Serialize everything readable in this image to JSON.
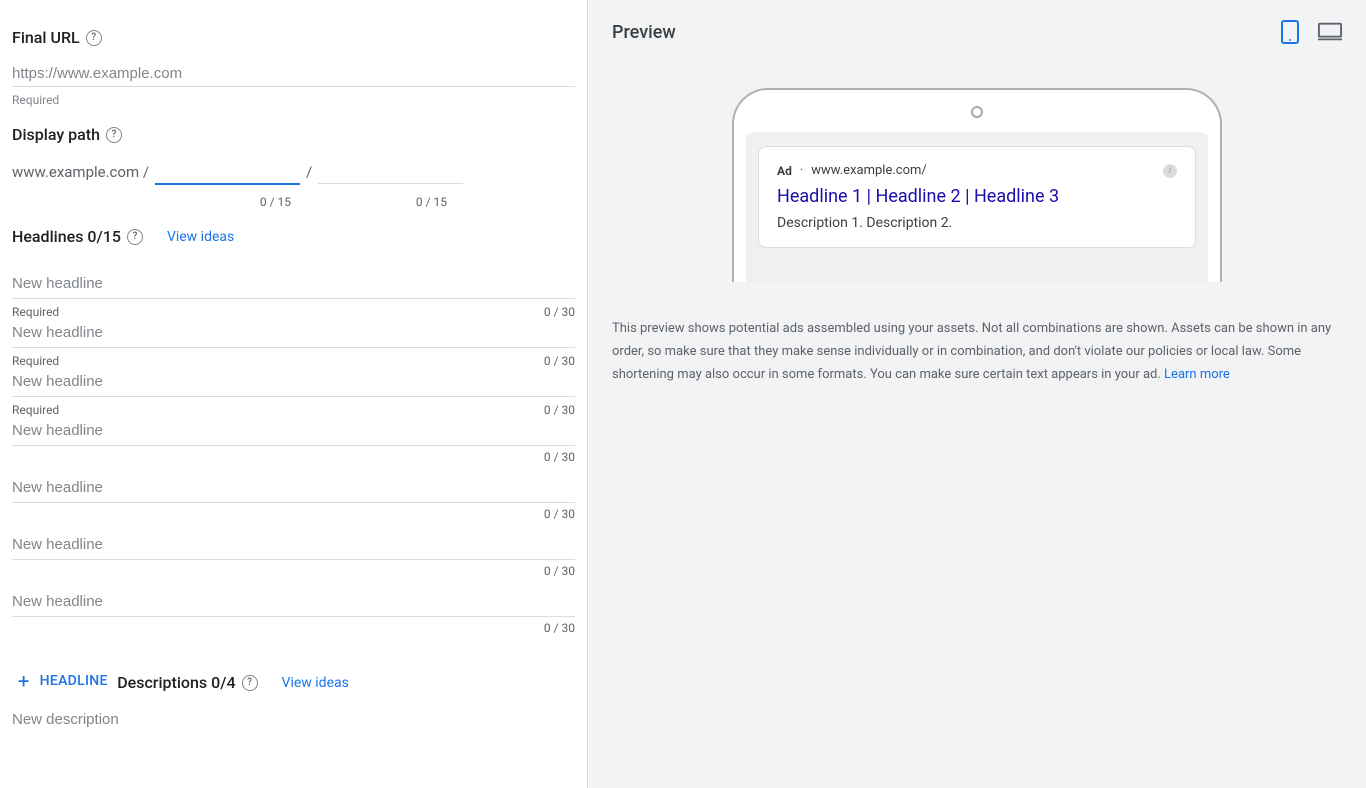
{
  "final_url": {
    "label": "Final URL",
    "placeholder": "https://www.example.com",
    "hint": "Required"
  },
  "display_path": {
    "label": "Display path",
    "prefix": "www.example.com /",
    "separator": "/",
    "counter1": "0 / 15",
    "counter2": "0 / 15"
  },
  "headlines": {
    "label": "Headlines 0/15",
    "view_ideas": "View ideas",
    "placeholder": "New headline",
    "required": "Required",
    "counter": "0 / 30",
    "add_button": "HEADLINE"
  },
  "descriptions": {
    "label": "Descriptions 0/4",
    "view_ideas": "View ideas",
    "placeholder": "New description"
  },
  "preview": {
    "title": "Preview",
    "ad_badge": "Ad",
    "ad_url": "www.example.com/",
    "ad_headline": "Headline 1 | Headline 2 | Headline 3",
    "ad_description": "Description 1. Description 2.",
    "explainer": "This preview shows potential ads assembled using your assets. Not all combinations are shown. Assets can be shown in any order, so make sure that they make sense individually or in combination, and don't violate our policies or local law. Some shortening may also occur in some formats. You can make sure certain text appears in your ad.",
    "learn_more": "Learn more"
  }
}
